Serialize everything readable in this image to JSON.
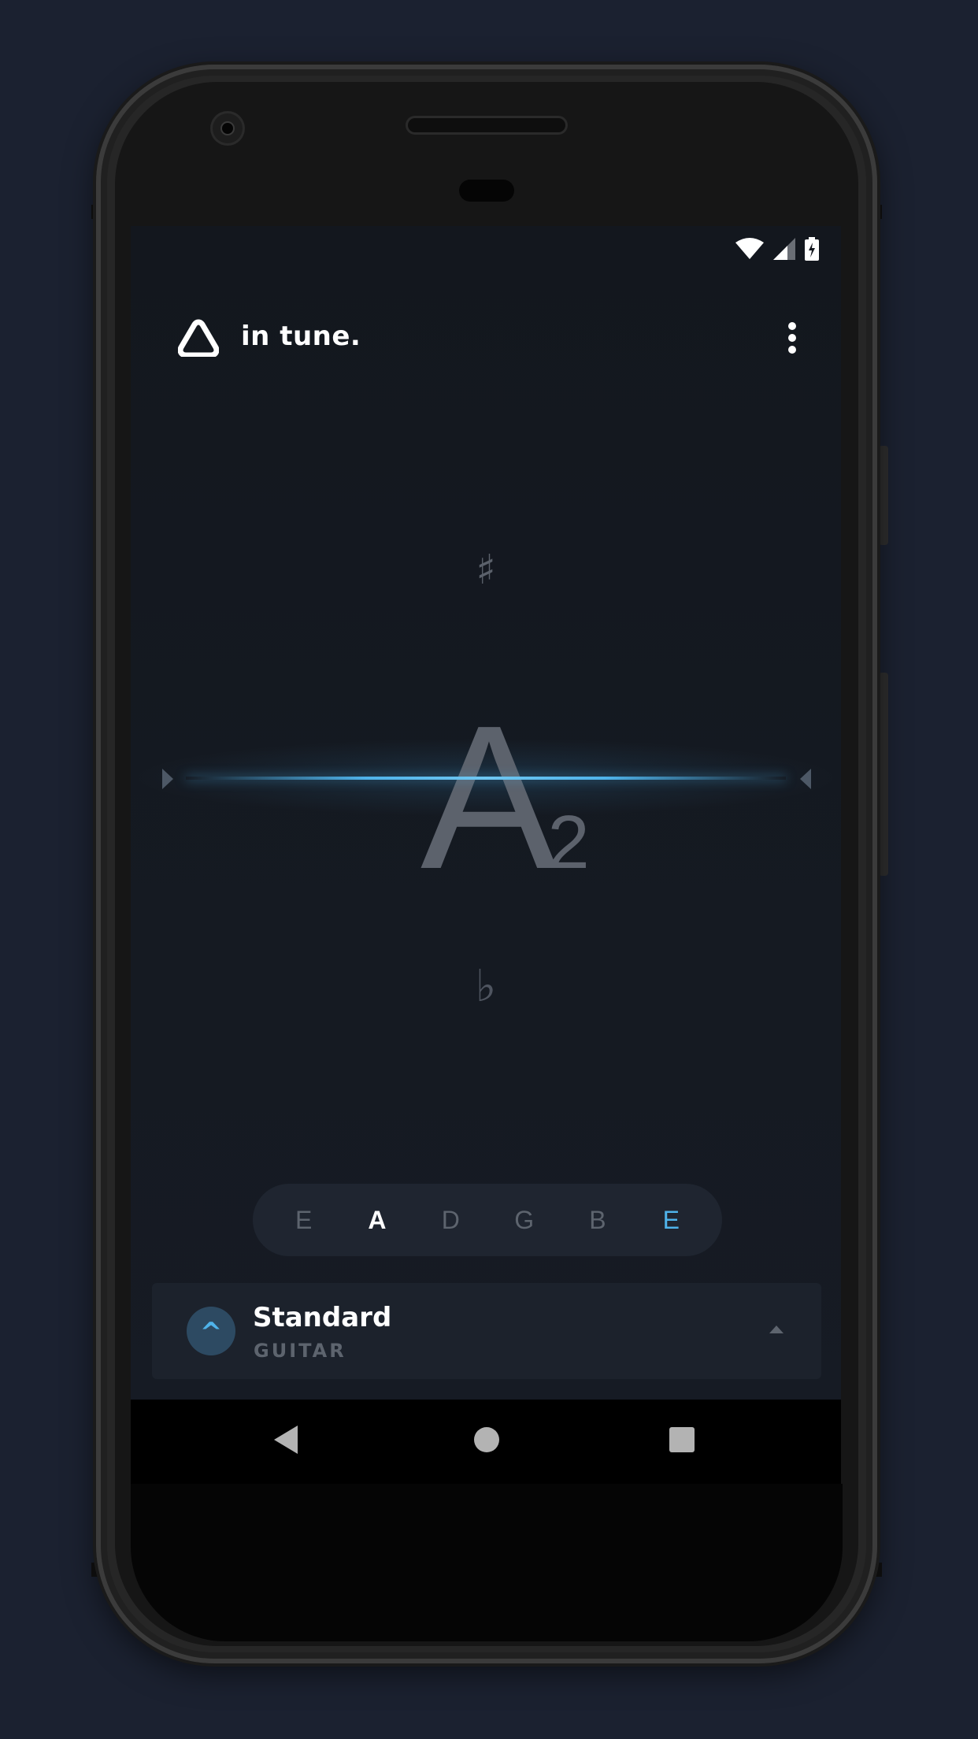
{
  "app": {
    "title": "in tune.",
    "logo_icon": "triangle-logo-icon",
    "menu_icon": "more-vert-icon"
  },
  "status_bar": {
    "icons": [
      "wifi-icon",
      "cellular-signal-icon",
      "battery-charging-icon"
    ]
  },
  "tuner": {
    "sharp_symbol": "♯",
    "flat_symbol": "♭",
    "note": "A",
    "octave": "2",
    "accent_color": "#4fb3ea"
  },
  "strings": [
    {
      "label": "E",
      "state": "default"
    },
    {
      "label": "A",
      "state": "active"
    },
    {
      "label": "D",
      "state": "default"
    },
    {
      "label": "G",
      "state": "default"
    },
    {
      "label": "B",
      "state": "default"
    },
    {
      "label": "E",
      "state": "accent"
    }
  ],
  "tuning": {
    "icon_glyph": "^",
    "name": "Standard",
    "instrument": "GUITAR"
  },
  "nav": {
    "icons": [
      "back-icon",
      "home-icon",
      "recents-icon"
    ]
  }
}
